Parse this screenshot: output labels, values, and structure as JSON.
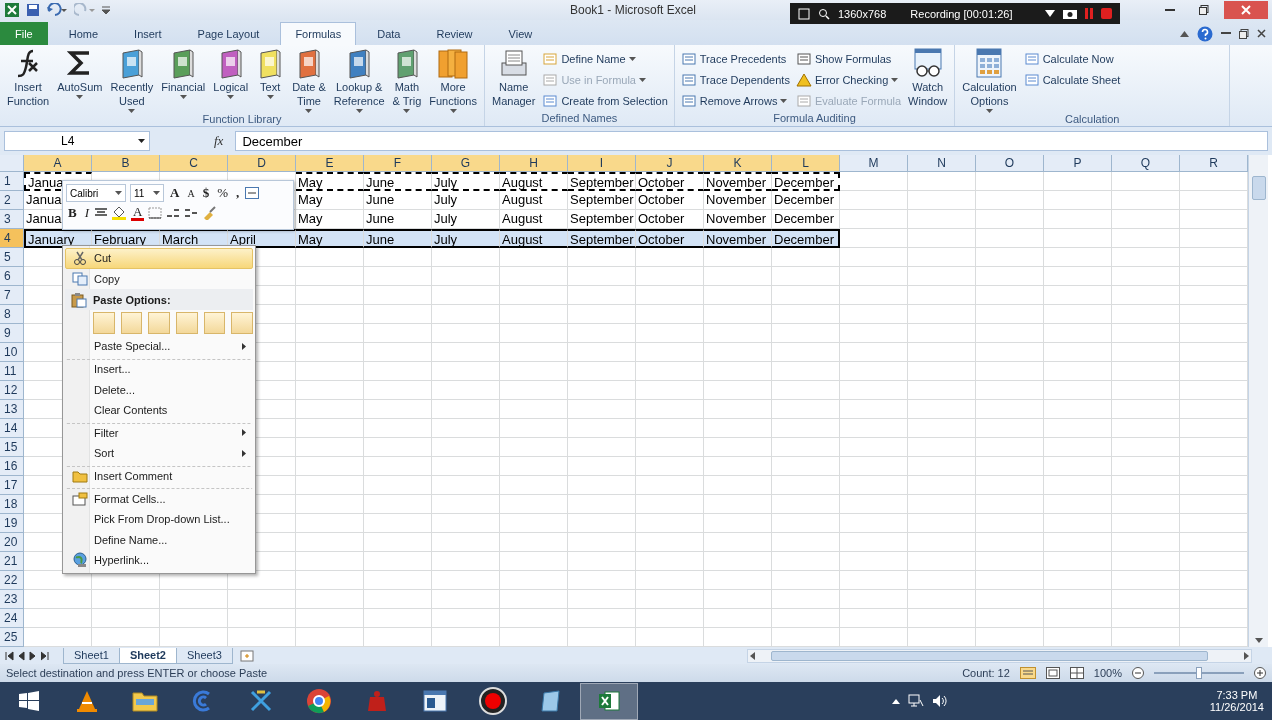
{
  "window": {
    "title": "Book1 - Microsoft Excel"
  },
  "recorder": {
    "resolution": "1360x768",
    "status": "Recording [00:01:26]"
  },
  "tabs": [
    {
      "label": "File",
      "kind": "file",
      "selected": false
    },
    {
      "label": "Home",
      "kind": "tab",
      "selected": false
    },
    {
      "label": "Insert",
      "kind": "tab",
      "selected": false
    },
    {
      "label": "Page Layout",
      "kind": "tab",
      "selected": false
    },
    {
      "label": "Formulas",
      "kind": "tab",
      "selected": true
    },
    {
      "label": "Data",
      "kind": "tab",
      "selected": false
    },
    {
      "label": "Review",
      "kind": "tab",
      "selected": false
    },
    {
      "label": "View",
      "kind": "tab",
      "selected": false
    }
  ],
  "ribbon_groups": [
    {
      "title": "Function Library",
      "buttons": [
        {
          "kind": "big",
          "lines": [
            "Insert",
            "Function"
          ],
          "dropdown": false,
          "disabled": false
        },
        {
          "kind": "big",
          "lines": [
            "AutoSum"
          ],
          "dropdown": true,
          "disabled": false
        },
        {
          "kind": "big",
          "lines": [
            "Recently",
            "Used"
          ],
          "dropdown": true,
          "disabled": false
        },
        {
          "kind": "big",
          "lines": [
            "Financial"
          ],
          "dropdown": true,
          "disabled": false
        },
        {
          "kind": "big",
          "lines": [
            "Logical"
          ],
          "dropdown": true,
          "disabled": false
        },
        {
          "kind": "big",
          "lines": [
            "Text"
          ],
          "dropdown": true,
          "disabled": false
        },
        {
          "kind": "big",
          "lines": [
            "Date &",
            "Time"
          ],
          "dropdown": true,
          "disabled": false
        },
        {
          "kind": "big",
          "lines": [
            "Lookup &",
            "Reference"
          ],
          "dropdown": true,
          "disabled": false
        },
        {
          "kind": "big",
          "lines": [
            "Math",
            "& Trig"
          ],
          "dropdown": true,
          "disabled": false
        },
        {
          "kind": "big",
          "lines": [
            "More",
            "Functions"
          ],
          "dropdown": true,
          "disabled": false
        }
      ]
    },
    {
      "title": "Defined Names",
      "buttons": [
        {
          "kind": "big",
          "lines": [
            "Name",
            "Manager"
          ],
          "dropdown": false,
          "disabled": false
        },
        {
          "kind": "small",
          "lines": [
            "Define Name"
          ],
          "dropdown": true,
          "disabled": false
        },
        {
          "kind": "small",
          "lines": [
            "Use in Formula"
          ],
          "dropdown": true,
          "disabled": true
        },
        {
          "kind": "small",
          "lines": [
            "Create from Selection"
          ],
          "dropdown": false,
          "disabled": false
        }
      ]
    },
    {
      "title": "Formula Auditing",
      "buttons": [
        {
          "kind": "small",
          "lines": [
            "Trace Precedents"
          ],
          "dropdown": false,
          "disabled": false
        },
        {
          "kind": "small",
          "lines": [
            "Trace Dependents"
          ],
          "dropdown": false,
          "disabled": false
        },
        {
          "kind": "small",
          "lines": [
            "Remove Arrows"
          ],
          "dropdown": true,
          "disabled": false
        },
        {
          "kind": "small",
          "lines": [
            "Show Formulas"
          ],
          "dropdown": false,
          "disabled": false
        },
        {
          "kind": "small",
          "lines": [
            "Error Checking"
          ],
          "dropdown": true,
          "disabled": false
        },
        {
          "kind": "small",
          "lines": [
            "Evaluate Formula"
          ],
          "dropdown": false,
          "disabled": true
        },
        {
          "kind": "big",
          "lines": [
            "Watch",
            "Window"
          ],
          "dropdown": false,
          "disabled": false
        }
      ]
    },
    {
      "title": "Calculation",
      "buttons": [
        {
          "kind": "big",
          "lines": [
            "Calculation",
            "Options"
          ],
          "dropdown": true,
          "disabled": false
        },
        {
          "kind": "small",
          "lines": [
            "Calculate Now"
          ],
          "dropdown": false,
          "disabled": false
        },
        {
          "kind": "small",
          "lines": [
            "Calculate Sheet"
          ],
          "dropdown": false,
          "disabled": false
        }
      ]
    }
  ],
  "formula_bar": {
    "name_box": "L4",
    "fx": "fx",
    "value": "December"
  },
  "columns": [
    {
      "label": "A",
      "selected": true
    },
    {
      "label": "B",
      "selected": true
    },
    {
      "label": "C",
      "selected": true
    },
    {
      "label": "D",
      "selected": true
    },
    {
      "label": "E",
      "selected": true
    },
    {
      "label": "F",
      "selected": true
    },
    {
      "label": "G",
      "selected": true
    },
    {
      "label": "H",
      "selected": true
    },
    {
      "label": "I",
      "selected": true
    },
    {
      "label": "J",
      "selected": true
    },
    {
      "label": "K",
      "selected": true
    },
    {
      "label": "L",
      "selected": true
    },
    {
      "label": "M",
      "selected": false
    },
    {
      "label": "N",
      "selected": false
    },
    {
      "label": "O",
      "selected": false
    },
    {
      "label": "P",
      "selected": false
    },
    {
      "label": "Q",
      "selected": false
    },
    {
      "label": "R",
      "selected": false
    }
  ],
  "rows": [
    {
      "header": "1",
      "selected": false,
      "marquee": true,
      "cells": [
        "Janua",
        null,
        null,
        null,
        "May",
        "June",
        "July",
        "August",
        "September",
        "October",
        "November",
        "December"
      ]
    },
    {
      "header": "2",
      "selected": false,
      "marquee": false,
      "cells": [
        "Janua",
        null,
        null,
        null,
        "May",
        "June",
        "July",
        "August",
        "September",
        "October",
        "November",
        "December"
      ]
    },
    {
      "header": "3",
      "selected": false,
      "marquee": false,
      "cells": [
        "Janua",
        null,
        null,
        null,
        "May",
        "June",
        "July",
        "August",
        "September",
        "October",
        "November",
        "December"
      ]
    },
    {
      "header": "4",
      "selected": true,
      "marquee": false,
      "cells": [
        "January",
        "February",
        "March",
        "April",
        "May",
        "June",
        "July",
        "August",
        "September",
        "October",
        "November",
        "December"
      ]
    },
    {
      "header": "5",
      "selected": false,
      "marquee": false
    },
    {
      "header": "6",
      "selected": false,
      "marquee": false
    },
    {
      "header": "7",
      "selected": false,
      "marquee": false
    },
    {
      "header": "8",
      "selected": false,
      "marquee": false
    },
    {
      "header": "9",
      "selected": false,
      "marquee": false
    },
    {
      "header": "10",
      "selected": false,
      "marquee": false
    },
    {
      "header": "11",
      "selected": false,
      "marquee": false
    },
    {
      "header": "12",
      "selected": false,
      "marquee": false
    },
    {
      "header": "13",
      "selected": false,
      "marquee": false
    },
    {
      "header": "14",
      "selected": false,
      "marquee": false
    },
    {
      "header": "15",
      "selected": false,
      "marquee": false
    },
    {
      "header": "16",
      "selected": false,
      "marquee": false
    },
    {
      "header": "17",
      "selected": false,
      "marquee": false
    },
    {
      "header": "18",
      "selected": false,
      "marquee": false
    },
    {
      "header": "19",
      "selected": false,
      "marquee": false
    },
    {
      "header": "20",
      "selected": false,
      "marquee": false
    },
    {
      "header": "21",
      "selected": false,
      "marquee": false
    },
    {
      "header": "22",
      "selected": false,
      "marquee": false
    },
    {
      "header": "23",
      "selected": false,
      "marquee": false
    },
    {
      "header": "24",
      "selected": false,
      "marquee": false
    },
    {
      "header": "25",
      "selected": false,
      "marquee": false
    }
  ],
  "mini_toolbar": {
    "font": "Calibri",
    "size": "11",
    "grow": "A",
    "shrink": "A",
    "currency": "$",
    "percent": "%",
    "comma": ",",
    "bold": "B",
    "italic": "I",
    "font_color": "A"
  },
  "context_menu": [
    {
      "kind": "item",
      "label": "Cut",
      "selected": true,
      "submenu": false,
      "separator_before": false
    },
    {
      "kind": "item",
      "label": "Copy",
      "selected": false,
      "submenu": false,
      "separator_before": false
    },
    {
      "kind": "header",
      "label": "Paste Options:",
      "selected": false
    },
    {
      "kind": "paste-row",
      "selected": false
    },
    {
      "kind": "item",
      "label": "Paste Special...",
      "selected": false,
      "submenu": true,
      "separator_before": false
    },
    {
      "kind": "item",
      "label": "Insert...",
      "selected": false,
      "submenu": false,
      "separator_before": true
    },
    {
      "kind": "item",
      "label": "Delete...",
      "selected": false,
      "submenu": false,
      "separator_before": false
    },
    {
      "kind": "item",
      "label": "Clear Contents",
      "selected": false,
      "submenu": false,
      "separator_before": false
    },
    {
      "kind": "item",
      "label": "Filter",
      "selected": false,
      "submenu": true,
      "separator_before": true
    },
    {
      "kind": "item",
      "label": "Sort",
      "selected": false,
      "submenu": true,
      "separator_before": false
    },
    {
      "kind": "item",
      "label": "Insert Comment",
      "selected": false,
      "submenu": false,
      "separator_before": true
    },
    {
      "kind": "item",
      "label": "Format Cells...",
      "selected": false,
      "submenu": false,
      "separator_before": true
    },
    {
      "kind": "item",
      "label": "Pick From Drop-down List...",
      "selected": false,
      "submenu": false,
      "separator_before": false
    },
    {
      "kind": "item",
      "label": "Define Name...",
      "selected": false,
      "submenu": false,
      "separator_before": false
    },
    {
      "kind": "item",
      "label": "Hyperlink...",
      "selected": false,
      "submenu": false,
      "separator_before": false
    }
  ],
  "sheet_tabs": [
    {
      "label": "Sheet1",
      "selected": false
    },
    {
      "label": "Sheet2",
      "selected": true
    },
    {
      "label": "Sheet3",
      "selected": false
    }
  ],
  "status_bar": {
    "message": "Select destination and press ENTER or choose Paste",
    "count": "Count: 12",
    "zoom": {
      "label": "100%",
      "level": 0.5
    }
  },
  "taskbar": {
    "apps": [
      {
        "kind": "cone",
        "selected": false
      },
      {
        "kind": "folder",
        "selected": false
      },
      {
        "kind": "swirl",
        "selected": false
      },
      {
        "kind": "tools",
        "selected": false
      },
      {
        "kind": "browser",
        "selected": false
      },
      {
        "kind": "bag",
        "selected": false
      },
      {
        "kind": "window",
        "selected": false
      },
      {
        "kind": "record",
        "selected": false
      },
      {
        "kind": "note",
        "selected": false
      },
      {
        "kind": "sheet",
        "selected": true
      }
    ],
    "time": "7:33 PM",
    "date": "11/26/2014"
  }
}
